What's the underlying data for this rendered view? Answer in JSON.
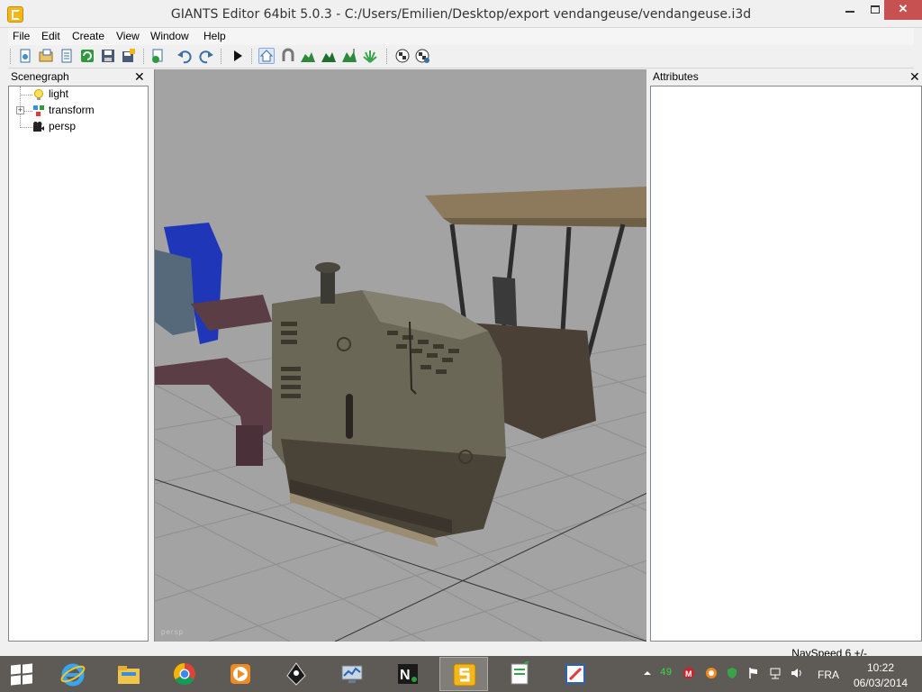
{
  "window": {
    "title": "GIANTS Editor 64bit 5.0.3 - C:/Users/Emilien/Desktop/export vendangeuse/vendangeuse.i3d",
    "close_glyph": "✕"
  },
  "menu": [
    "File",
    "Edit",
    "Create",
    "View",
    "Window",
    "Help"
  ],
  "toolbar": {
    "icons": [
      "new-file-icon",
      "open-file-icon",
      "list-icon",
      "refresh-icon",
      "save-icon",
      "save-all-icon",
      "import-icon",
      "undo-icon",
      "redo-icon",
      "play-icon",
      "home-icon",
      "magnet-icon",
      "terrain-icon",
      "terrain-paint-icon",
      "terrain-height-icon",
      "foliage-icon",
      "checker-icon",
      "checker-settings-icon"
    ]
  },
  "scenegraph": {
    "title": "Scenegraph",
    "close": "✕",
    "items": [
      {
        "label": "light",
        "icon": "light-bulb-icon",
        "expandable": false
      },
      {
        "label": "transform",
        "icon": "transform-group-icon",
        "expandable": true,
        "expander": "+"
      },
      {
        "label": "persp",
        "icon": "camera-icon",
        "expandable": false
      }
    ]
  },
  "attributes": {
    "title": "Attributes",
    "close": "✕"
  },
  "viewport": {
    "camera_label": "persp"
  },
  "status": {
    "navspeed": "NavSpeed 6 +/-"
  },
  "taskbar": {
    "apps": [
      "internet-explorer-icon",
      "file-explorer-icon",
      "chrome-icon",
      "media-player-icon",
      "inkscape-icon",
      "system-monitor-icon",
      "notepad-plus-icon",
      "giants-editor-icon",
      "text-editor-icon",
      "paint-icon"
    ],
    "tray_counter": "49",
    "language": "FRA",
    "time": "10:22",
    "date": "06/03/2014"
  },
  "colors": {
    "viewport_bg": "#a3a3a3",
    "taskbar_bg": "#5e5a55",
    "close_button": "#c75050",
    "app_icon": "#f3b71b"
  }
}
